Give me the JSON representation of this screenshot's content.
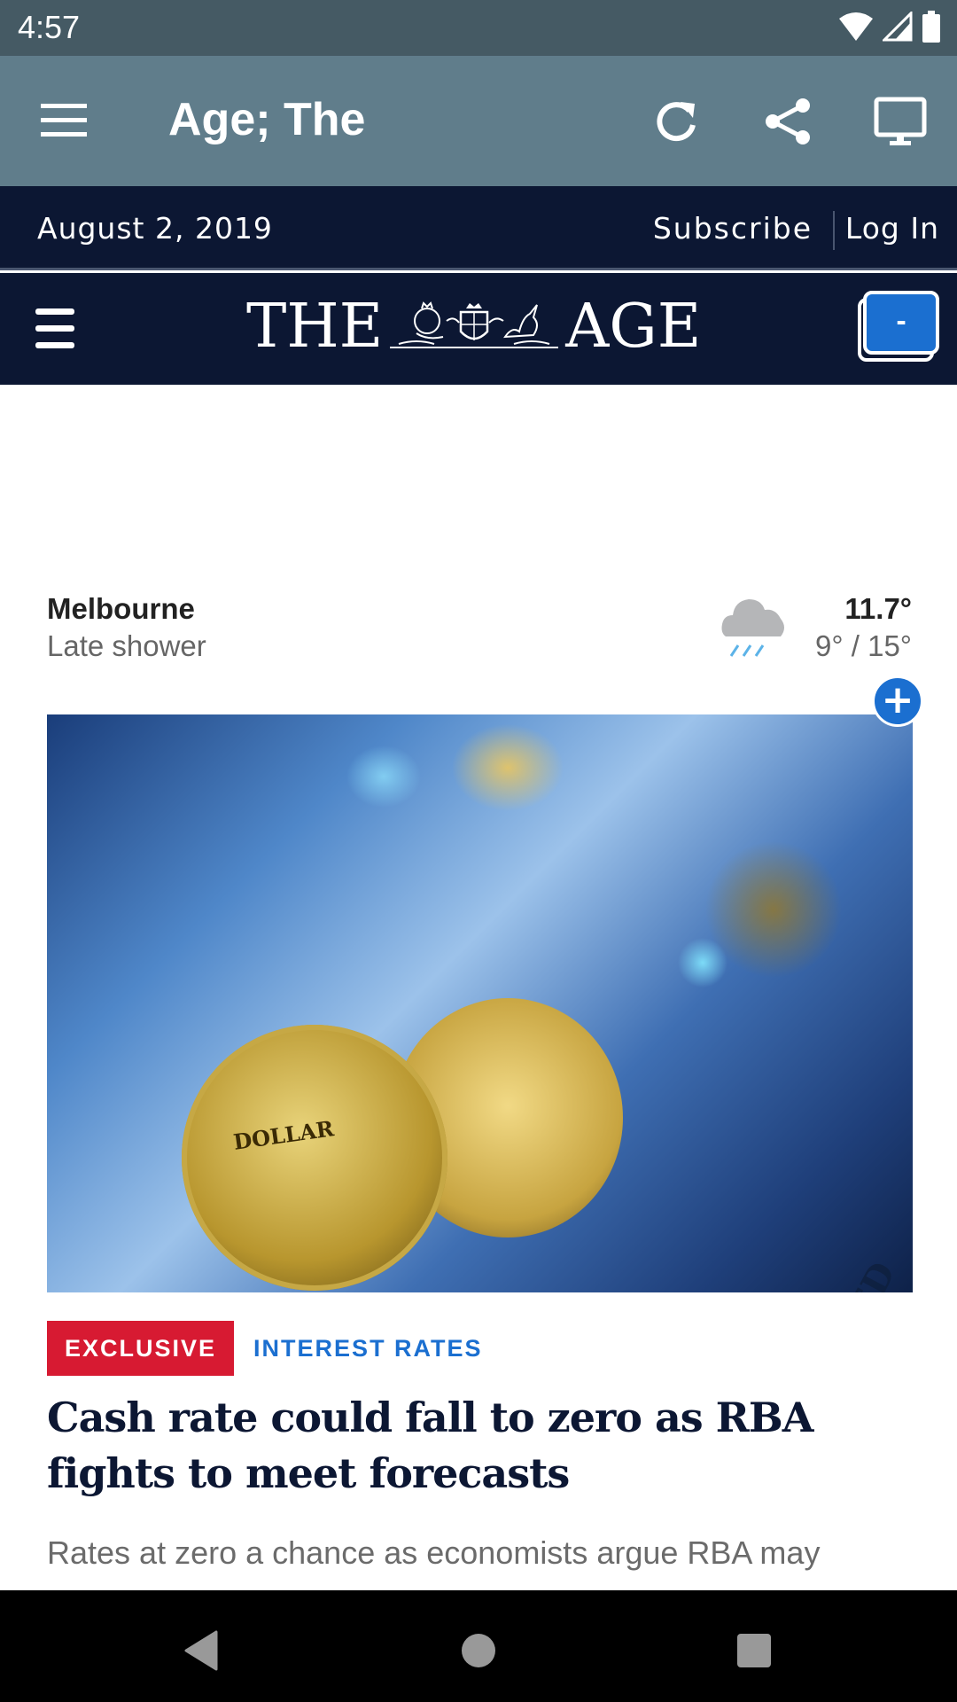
{
  "status_bar": {
    "time": "4:57",
    "icons": [
      "wifi-icon",
      "cell-signal-icon",
      "battery-icon"
    ]
  },
  "app_bar": {
    "title": "Age; The",
    "menu_icon": "hamburger-menu-icon",
    "actions": [
      {
        "name": "refresh",
        "icon": "refresh-icon"
      },
      {
        "name": "share",
        "icon": "share-icon"
      },
      {
        "name": "desktop-view",
        "icon": "desktop-monitor-icon"
      }
    ]
  },
  "site_header": {
    "date": "August 2, 2019",
    "subscribe_label": "Subscribe",
    "login_label": "Log In",
    "logo_left": "THE",
    "logo_right": "AGE",
    "tabs_button_label": "-"
  },
  "weather": {
    "city": "Melbourne",
    "description": "Late shower",
    "icon": "rain-cloud-icon",
    "current_temp": "11.7°",
    "range": "9° / 15°"
  },
  "floating_add_label": "+",
  "article": {
    "image_alt": "Australian dollar coins on US banknotes",
    "image_coin_text": "DOLLAR",
    "image_note_text": "UNITED",
    "tag_label": "EXCLUSIVE",
    "topic_label": "INTEREST RATES",
    "headline": "Cash rate could fall to zero as RBA fights to meet forecasts",
    "summary": "Rates at zero a chance as economists argue RBA may need to do more to meet its key forecasts"
  },
  "colors": {
    "status_bar": "#455a64",
    "app_bar": "#607d8b",
    "site_header": "#0c1733",
    "accent_blue": "#1b6fd0",
    "exclusive_red": "#d71a32"
  },
  "nav_bar": {
    "buttons": [
      "back-icon",
      "home-icon",
      "recents-icon"
    ]
  }
}
